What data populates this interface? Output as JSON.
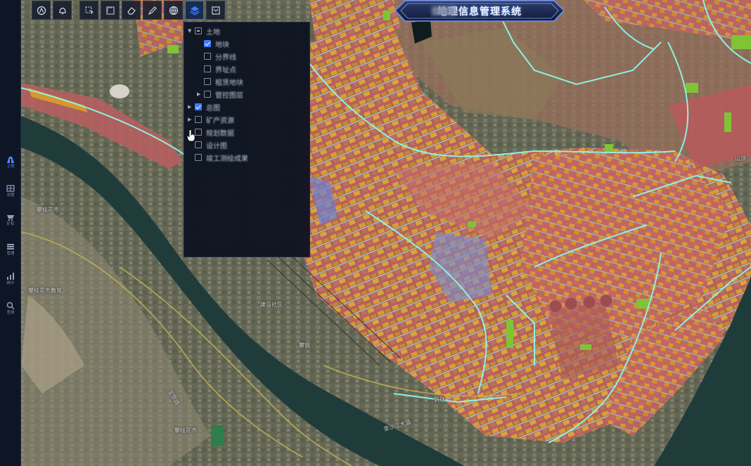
{
  "title": {
    "text": "地理信息管理系统"
  },
  "toolbar": {
    "buttons": [
      {
        "name": "home-icon"
      },
      {
        "name": "bell-icon"
      },
      {
        "name": "select-icon"
      },
      {
        "name": "measure-area-icon"
      },
      {
        "name": "eraser-icon"
      },
      {
        "name": "draw-icon"
      },
      {
        "name": "globe-icon"
      },
      {
        "name": "layers-icon",
        "active": true
      },
      {
        "name": "export-icon"
      }
    ]
  },
  "sidebar": {
    "items": [
      {
        "label": "土地",
        "icon": "land-icon",
        "active": true
      },
      {
        "label": "总图",
        "icon": "general-map-icon"
      },
      {
        "label": "矿权",
        "icon": "mining-cart-icon"
      },
      {
        "label": "管理",
        "icon": "manage-icon"
      },
      {
        "label": "统计",
        "icon": "stats-icon"
      },
      {
        "label": "查询",
        "icon": "search-icon"
      }
    ]
  },
  "layer_panel": {
    "nodes": [
      {
        "label": "土地",
        "level": 0,
        "expanded": true,
        "state": "partial",
        "has_arrow": true
      },
      {
        "label": "地块",
        "level": 1,
        "state": "checked"
      },
      {
        "label": "分界线",
        "level": 1,
        "state": "unchecked"
      },
      {
        "label": "界址点",
        "level": 1,
        "state": "unchecked"
      },
      {
        "label": "租赁地块",
        "level": 1,
        "state": "unchecked"
      },
      {
        "label": "管控图层",
        "level": 1,
        "state": "unchecked",
        "has_arrow": true
      },
      {
        "label": "总图",
        "level": 0,
        "state": "checked",
        "has_arrow": true
      },
      {
        "label": "矿产资源",
        "level": 0,
        "state": "unchecked",
        "has_arrow": true
      },
      {
        "label": "规划数据",
        "level": 0,
        "state": "unchecked"
      },
      {
        "label": "设计图",
        "level": 0,
        "state": "unchecked"
      },
      {
        "label": "竣工测绘成果",
        "level": 0,
        "state": "unchecked"
      }
    ]
  },
  "map_labels": [
    {
      "text": "攀枝花市",
      "id": "label-1"
    },
    {
      "text": "攀枝花市教育",
      "id": "label-2"
    },
    {
      "text": "攀枝花市",
      "id": "label-3"
    },
    {
      "text": "建设社区",
      "id": "label-4"
    },
    {
      "text": "宝鼎路",
      "id": "label-5"
    },
    {
      "text": "金沙江大道",
      "id": "label-6"
    },
    {
      "text": "攀钢",
      "id": "label-7"
    },
    {
      "text": "钒钛",
      "id": "label-8"
    },
    {
      "text": "山顶",
      "id": "label-9"
    }
  ],
  "colors": {
    "parcel_red": "#b85c5c",
    "parcel_orange": "#d8972c",
    "road_cyan": "#7ef0e4",
    "green_patch": "#7fc435",
    "river": "#1d3b3c",
    "accent_blue": "#3b7cff"
  }
}
